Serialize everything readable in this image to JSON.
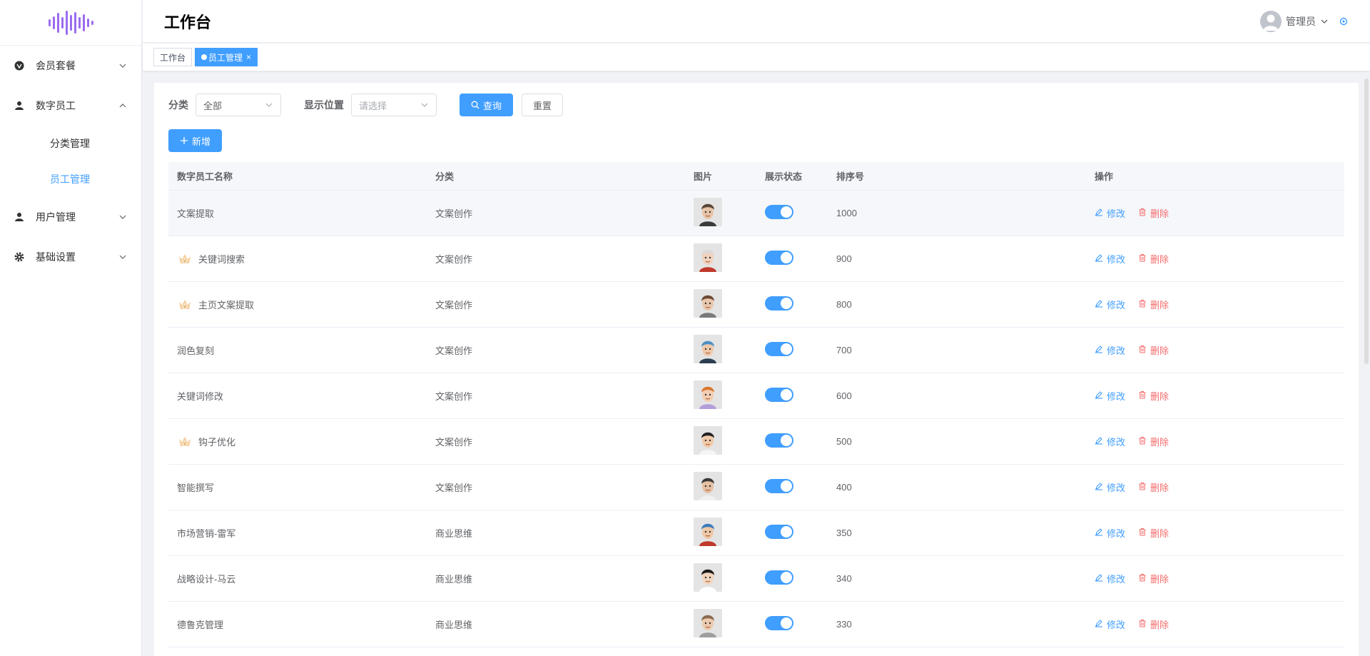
{
  "header": {
    "title": "工作台",
    "user_name": "管理员"
  },
  "sidebar": {
    "items": [
      {
        "label": "会员套餐",
        "icon": "vip-icon",
        "expanded": false
      },
      {
        "label": "数字员工",
        "icon": "user-icon",
        "expanded": true,
        "children": [
          {
            "label": "分类管理",
            "active": false
          },
          {
            "label": "员工管理",
            "active": true
          }
        ]
      },
      {
        "label": "用户管理",
        "icon": "user-icon",
        "expanded": false
      },
      {
        "label": "基础设置",
        "icon": "gear-icon",
        "expanded": false
      }
    ]
  },
  "tabs": [
    {
      "label": "工作台",
      "active": false
    },
    {
      "label": "员工管理",
      "active": true
    }
  ],
  "filters": {
    "category_label": "分类",
    "category_value": "全部",
    "position_label": "显示位置",
    "position_placeholder": "请选择",
    "query_label": "查询",
    "reset_label": "重置"
  },
  "add_label": "新增",
  "table": {
    "headers": [
      "数字员工名称",
      "分类",
      "图片",
      "展示状态",
      "排序号",
      "操作"
    ],
    "edit_label": "修改",
    "delete_label": "删除",
    "rows": [
      {
        "name": "文案提取",
        "vip": false,
        "category": "文案创作",
        "sort": "1000",
        "enabled": true
      },
      {
        "name": "关键词搜索",
        "vip": true,
        "category": "文案创作",
        "sort": "900",
        "enabled": true
      },
      {
        "name": "主页文案提取",
        "vip": true,
        "category": "文案创作",
        "sort": "800",
        "enabled": true
      },
      {
        "name": "润色复刻",
        "vip": false,
        "category": "文案创作",
        "sort": "700",
        "enabled": true
      },
      {
        "name": "关键词修改",
        "vip": false,
        "category": "文案创作",
        "sort": "600",
        "enabled": true
      },
      {
        "name": "钩子优化",
        "vip": true,
        "category": "文案创作",
        "sort": "500",
        "enabled": true
      },
      {
        "name": "智能撰写",
        "vip": false,
        "category": "文案创作",
        "sort": "400",
        "enabled": true
      },
      {
        "name": "市场营销-雷军",
        "vip": false,
        "category": "商业思维",
        "sort": "350",
        "enabled": true
      },
      {
        "name": "战略设计-马云",
        "vip": false,
        "category": "商业思维",
        "sort": "340",
        "enabled": true
      },
      {
        "name": "德鲁克管理",
        "vip": false,
        "category": "商业思维",
        "sort": "330",
        "enabled": true
      }
    ]
  },
  "colors": {
    "primary": "#409eff",
    "danger": "#f56c6c",
    "logo": "#8b5cf6"
  }
}
